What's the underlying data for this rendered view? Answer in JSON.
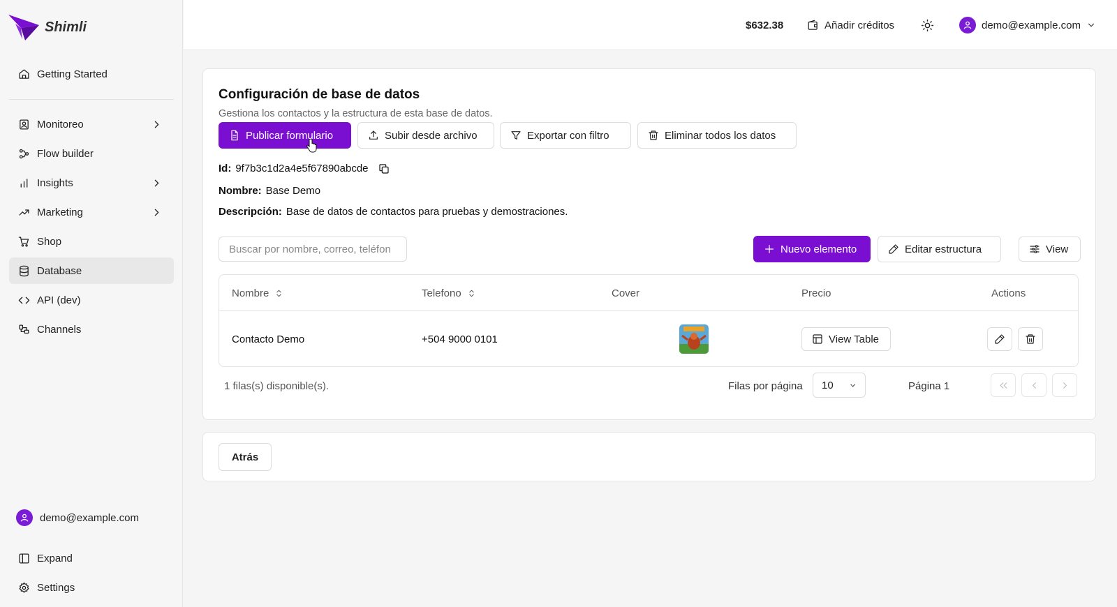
{
  "app": {
    "name": "Shimli",
    "brand_color": "#7a0fd1"
  },
  "sidebar": {
    "items": [
      {
        "label": "Getting Started",
        "icon": "home-icon"
      },
      {
        "label": "Monitoreo",
        "icon": "monitor-icon",
        "has_submenu": true
      },
      {
        "label": "Flow builder",
        "icon": "workflow-icon"
      },
      {
        "label": "Insights",
        "icon": "bar-chart-icon",
        "has_submenu": true
      },
      {
        "label": "Marketing",
        "icon": "trending-up-icon",
        "has_submenu": true
      },
      {
        "label": "Shop",
        "icon": "cart-icon"
      },
      {
        "label": "Database",
        "icon": "database-icon",
        "active": true
      },
      {
        "label": "API (dev)",
        "icon": "code-icon"
      },
      {
        "label": "Channels",
        "icon": "channels-icon"
      }
    ],
    "user_email": "demo@example.com",
    "expand_label": "Expand",
    "settings_label": "Settings"
  },
  "header": {
    "balance": "$632.38",
    "add_credits_label": "Añadir créditos",
    "user_email": "demo@example.com"
  },
  "main": {
    "title": "Configuración de base de datos",
    "subtitle": "Gestiona los contactos y la estructura de esta base de datos.",
    "actions": {
      "publish": "Publicar formulario",
      "upload": "Subir desde archivo",
      "export": "Exportar con filtro",
      "delete_all": "Eliminar todos los datos"
    },
    "id_label": "Id:",
    "id_value": "9f7b3c1d2a4e5f67890abcde",
    "name_label": "Nombre:",
    "name_value": "Base Demo",
    "description_label": "Descripción:",
    "description_value": "Base de datos de contactos para pruebas y demostraciones.",
    "search_placeholder": "Buscar por nombre, correo, teléfon",
    "new_item_label": "Nuevo elemento",
    "edit_structure_label": "Editar estructura",
    "view_label": "View",
    "table": {
      "columns": [
        "Nombre",
        "Telefono",
        "Cover",
        "Precio",
        "Actions"
      ],
      "rows": [
        {
          "nombre": "Contacto Demo",
          "telefono": "+504 9000 0101",
          "cover": "game-cover-image",
          "precio_button": "View Table"
        }
      ]
    },
    "footer": {
      "rows_available": "1 filas(s) disponible(s).",
      "rows_per_page_label": "Filas por página",
      "rows_per_page_value": "10",
      "page_label": "Página 1"
    },
    "back_label": "Atrás"
  }
}
